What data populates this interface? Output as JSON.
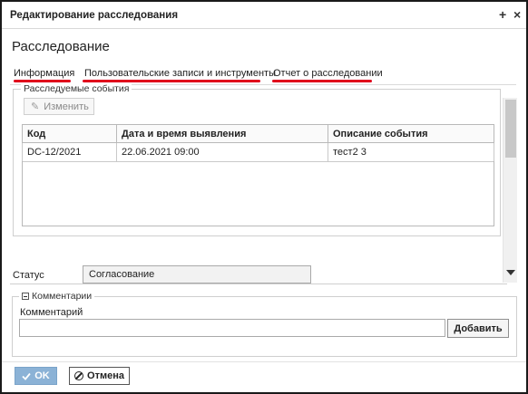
{
  "window": {
    "title": "Редактирование расследования",
    "pin_glyph": "+",
    "close_glyph": "×"
  },
  "heading": "Расследование",
  "tabs": [
    {
      "label": "Информация",
      "active": true
    },
    {
      "label": "Пользовательские записи и инструменты",
      "active": false
    },
    {
      "label": "Отчет о расследовании",
      "active": false
    }
  ],
  "events": {
    "legend": "Расследуемые события",
    "edit_button": "Изменить",
    "columns": [
      "Код",
      "Дата и время выявления",
      "Описание события"
    ],
    "rows": [
      [
        "DC-12/2021",
        "22.06.2021 09:00",
        "тест2 3"
      ]
    ]
  },
  "status": {
    "label": "Статус",
    "value": "Согласование"
  },
  "comments": {
    "legend": "Комментарии",
    "field_label": "Комментарий",
    "value": "",
    "add_button": "Добавить"
  },
  "footer": {
    "ok_label": "OK",
    "cancel_label": "Отмена"
  },
  "colors": {
    "accent_underline": "#e0001b",
    "ok_button": "#8bb2d6"
  }
}
